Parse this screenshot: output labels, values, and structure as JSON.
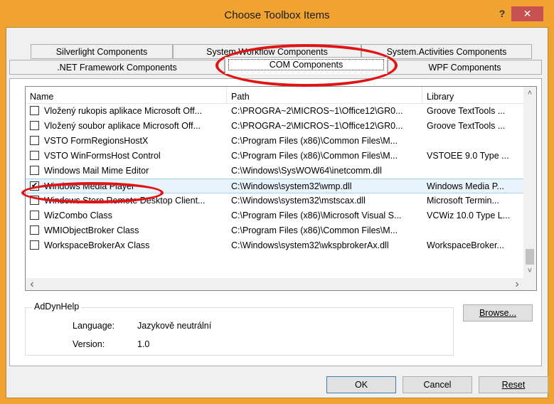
{
  "window": {
    "title": "Choose Toolbox Items",
    "help_label": "?",
    "close_label": "✕"
  },
  "tabs": {
    "row_back": [
      "Silverlight Components",
      "System.Workflow Components",
      "System.Activities Components"
    ],
    "row_front": [
      ".NET Framework Components",
      "COM Components",
      "WPF Components"
    ],
    "selected": "COM Components"
  },
  "list": {
    "columns": [
      "Name",
      "Path",
      "Library"
    ],
    "rows": [
      {
        "checked": false,
        "name": "Vložený rukopis aplikace Microsoft Off...",
        "path": "C:\\PROGRA~2\\MICROS~1\\Office12\\GR0...",
        "library": "Groove TextTools ..."
      },
      {
        "checked": false,
        "name": "Vložený soubor aplikace Microsoft Off...",
        "path": "C:\\PROGRA~2\\MICROS~1\\Office12\\GR0...",
        "library": "Groove TextTools ..."
      },
      {
        "checked": false,
        "name": "VSTO FormRegionsHostX",
        "path": "C:\\Program Files (x86)\\Common Files\\M...",
        "library": ""
      },
      {
        "checked": false,
        "name": "VSTO WinFormsHost Control",
        "path": "C:\\Program Files (x86)\\Common Files\\M...",
        "library": "VSTOEE 9.0 Type ..."
      },
      {
        "checked": false,
        "name": "Windows Mail Mime Editor",
        "path": "C:\\Windows\\SysWOW64\\inetcomm.dll",
        "library": ""
      },
      {
        "checked": true,
        "name": "Windows Media Player",
        "path": "C:\\Windows\\system32\\wmp.dll",
        "library": "Windows Media P..."
      },
      {
        "checked": false,
        "name": "Windows Store Remote Desktop Client...",
        "path": "C:\\Windows\\system32\\mstscax.dll",
        "library": "Microsoft Termin..."
      },
      {
        "checked": false,
        "name": "WizCombo Class",
        "path": "C:\\Program Files (x86)\\Microsoft Visual S...",
        "library": "VCWiz 10.0 Type L..."
      },
      {
        "checked": false,
        "name": "WMIObjectBroker Class",
        "path": "C:\\Program Files (x86)\\Common Files\\M...",
        "library": ""
      },
      {
        "checked": false,
        "name": "WorkspaceBrokerAx Class",
        "path": "C:\\Windows\\system32\\wkspbrokerAx.dll",
        "library": "WorkspaceBroker..."
      }
    ],
    "check_glyph": "✔",
    "arrows": {
      "up": "˄",
      "down": "˅",
      "left": "‹",
      "right": "›"
    }
  },
  "details": {
    "group_title": "AdDynHelp",
    "language_label": "Language:",
    "language_value": "Jazykově neutrální",
    "version_label": "Version:",
    "version_value": "1.0"
  },
  "buttons": {
    "browse": "Browse...",
    "ok": "OK",
    "cancel": "Cancel",
    "reset": "Reset"
  },
  "colors": {
    "title_bar": "#f0a330",
    "close_button": "#c75050",
    "annotation": "#e01414",
    "selected_row": "#e8f4fb"
  }
}
